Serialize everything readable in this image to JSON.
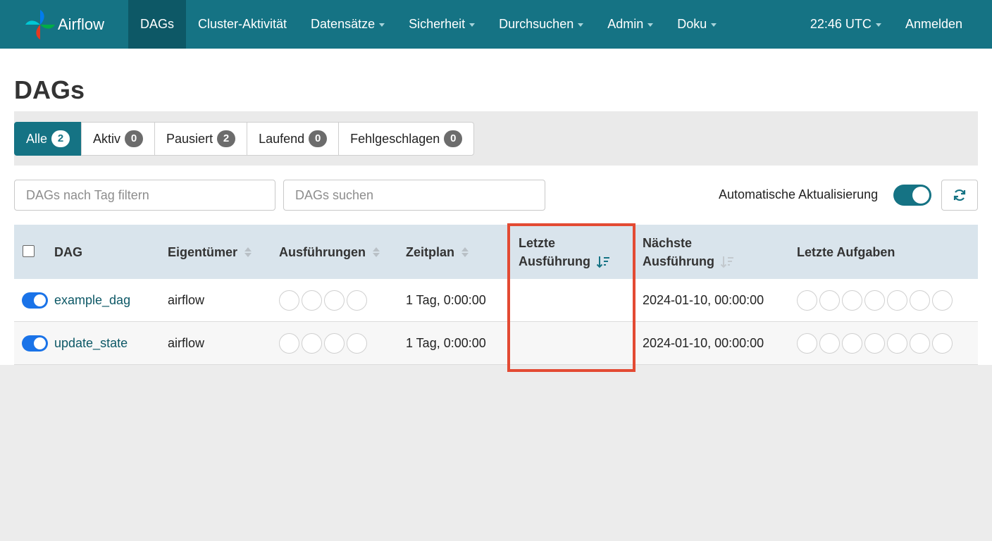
{
  "navbar": {
    "brand": "Airflow",
    "items": [
      {
        "label": "DAGs",
        "active": true,
        "dropdown": false
      },
      {
        "label": "Cluster-Aktivität",
        "active": false,
        "dropdown": false
      },
      {
        "label": "Datensätze",
        "active": false,
        "dropdown": true
      },
      {
        "label": "Sicherheit",
        "active": false,
        "dropdown": true
      },
      {
        "label": "Durchsuchen",
        "active": false,
        "dropdown": true
      },
      {
        "label": "Admin",
        "active": false,
        "dropdown": true
      },
      {
        "label": "Doku",
        "active": false,
        "dropdown": true
      }
    ],
    "time": "22:46 UTC",
    "login": "Anmelden"
  },
  "page": {
    "title": "DAGs"
  },
  "filters": [
    {
      "label": "Alle",
      "count": "2",
      "active": true
    },
    {
      "label": "Aktiv",
      "count": "0",
      "active": false
    },
    {
      "label": "Pausiert",
      "count": "2",
      "active": false
    },
    {
      "label": "Laufend",
      "count": "0",
      "active": false
    },
    {
      "label": "Fehlgeschlagen",
      "count": "0",
      "active": false
    }
  ],
  "search": {
    "tag_placeholder": "DAGs nach Tag filtern",
    "dag_placeholder": "DAGs suchen",
    "auto_refresh_label": "Automatische Aktualisierung",
    "auto_refresh_on": true
  },
  "table": {
    "columns": {
      "dag": "DAG",
      "owner": "Eigentümer",
      "runs": "Ausführungen",
      "schedule": "Zeitplan",
      "last_run_1": "Letzte",
      "last_run_2": "Ausführung",
      "next_run_1": "Nächste",
      "next_run_2": "Ausführung",
      "recent_tasks": "Letzte Aufgaben"
    },
    "rows": [
      {
        "dag_id": "example_dag",
        "owner": "airflow",
        "schedule": "1 Tag, 0:00:00",
        "last_run": "",
        "next_run": "2024-01-10, 00:00:00",
        "enabled": true
      },
      {
        "dag_id": "update_state",
        "owner": "airflow",
        "schedule": "1 Tag, 0:00:00",
        "last_run": "",
        "next_run": "2024-01-10, 00:00:00",
        "enabled": true
      }
    ]
  },
  "colors": {
    "primary": "#157384",
    "primary_dark": "#0d5866",
    "toggle_blue": "#1a73e8",
    "highlight": "#e34a33"
  },
  "icons": {
    "brand": "airflow-pinwheel-icon",
    "refresh": "refresh-icon",
    "sort_active": "sort-descending-icon",
    "sort_inactive": "sort-both-icon"
  }
}
